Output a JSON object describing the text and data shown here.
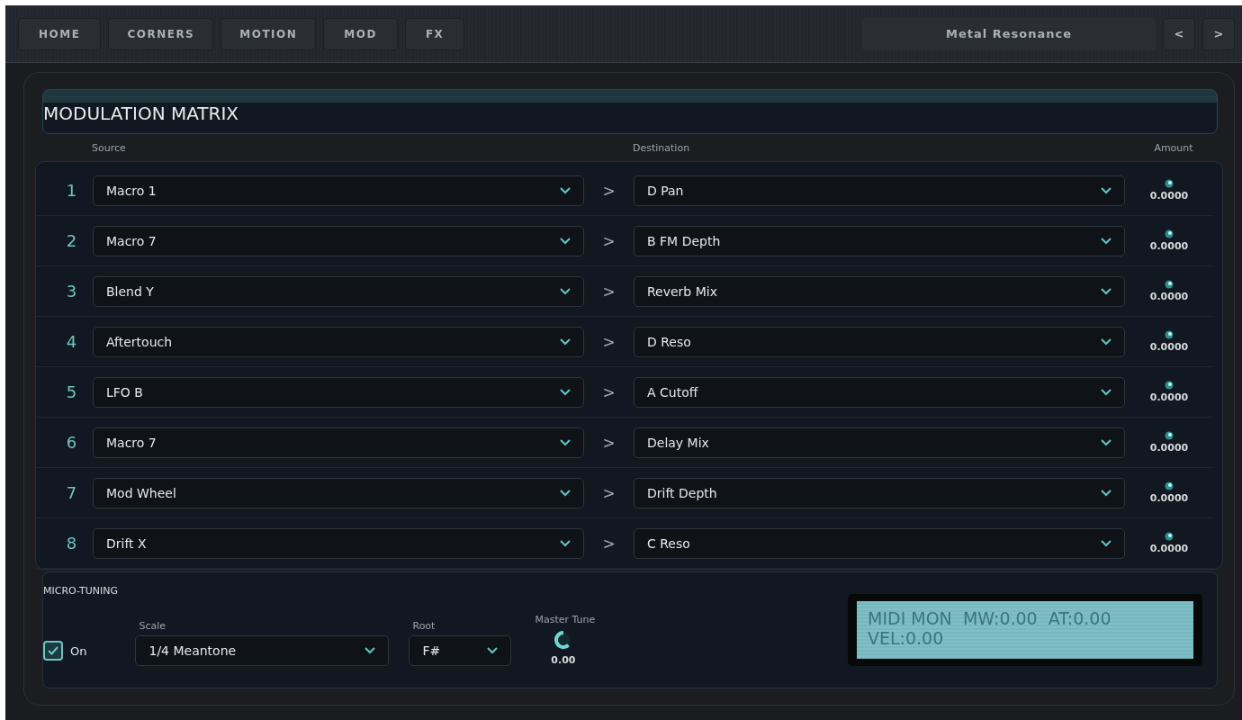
{
  "nav": {
    "tabs": [
      {
        "label": "HOME",
        "selected": false
      },
      {
        "label": "CORNERS",
        "selected": false
      },
      {
        "label": "MOTION",
        "selected": false
      },
      {
        "label": "MOD",
        "selected": false
      },
      {
        "label": "FX",
        "selected": false
      }
    ],
    "preset": "Metal Resonance",
    "prev": "<",
    "next": ">"
  },
  "matrix": {
    "title": "MODULATION MATRIX",
    "columns": {
      "source": "Source",
      "destination": "Destination",
      "amount": "Amount"
    },
    "rows": [
      {
        "number": "1",
        "source": "Macro 1",
        "arrow": ">",
        "destination": "D Pan",
        "amount": "0.0000"
      },
      {
        "number": "2",
        "source": "Macro 7",
        "arrow": ">",
        "destination": "B FM Depth",
        "amount": "0.0000"
      },
      {
        "number": "3",
        "source": "Blend Y",
        "arrow": ">",
        "destination": "Reverb Mix",
        "amount": "0.0000"
      },
      {
        "number": "4",
        "source": "Aftertouch",
        "arrow": ">",
        "destination": "D Reso",
        "amount": "0.0000"
      },
      {
        "number": "5",
        "source": "LFO B",
        "arrow": ">",
        "destination": "A Cutoff",
        "amount": "0.0000"
      },
      {
        "number": "6",
        "source": "Macro 7",
        "arrow": ">",
        "destination": "Delay Mix",
        "amount": "0.0000"
      },
      {
        "number": "7",
        "source": "Mod Wheel",
        "arrow": ">",
        "destination": "Drift Depth",
        "amount": "0.0000"
      },
      {
        "number": "8",
        "source": "Drift X",
        "arrow": ">",
        "destination": "C Reso",
        "amount": "0.0000"
      }
    ]
  },
  "micro_tuning": {
    "title": "MICRO-TUNING",
    "on": {
      "label": "On",
      "checked": true
    },
    "scale": {
      "label": "Scale",
      "value": "1/4 Meantone"
    },
    "root": {
      "label": "Root",
      "value": "F#"
    },
    "master_tune": {
      "label": "Master Tune",
      "value": "0.00"
    },
    "midi_monitor": {
      "lines": [
        "MIDI MON  MW:0.00  AT:0.00",
        "VEL:0.00"
      ]
    }
  }
}
